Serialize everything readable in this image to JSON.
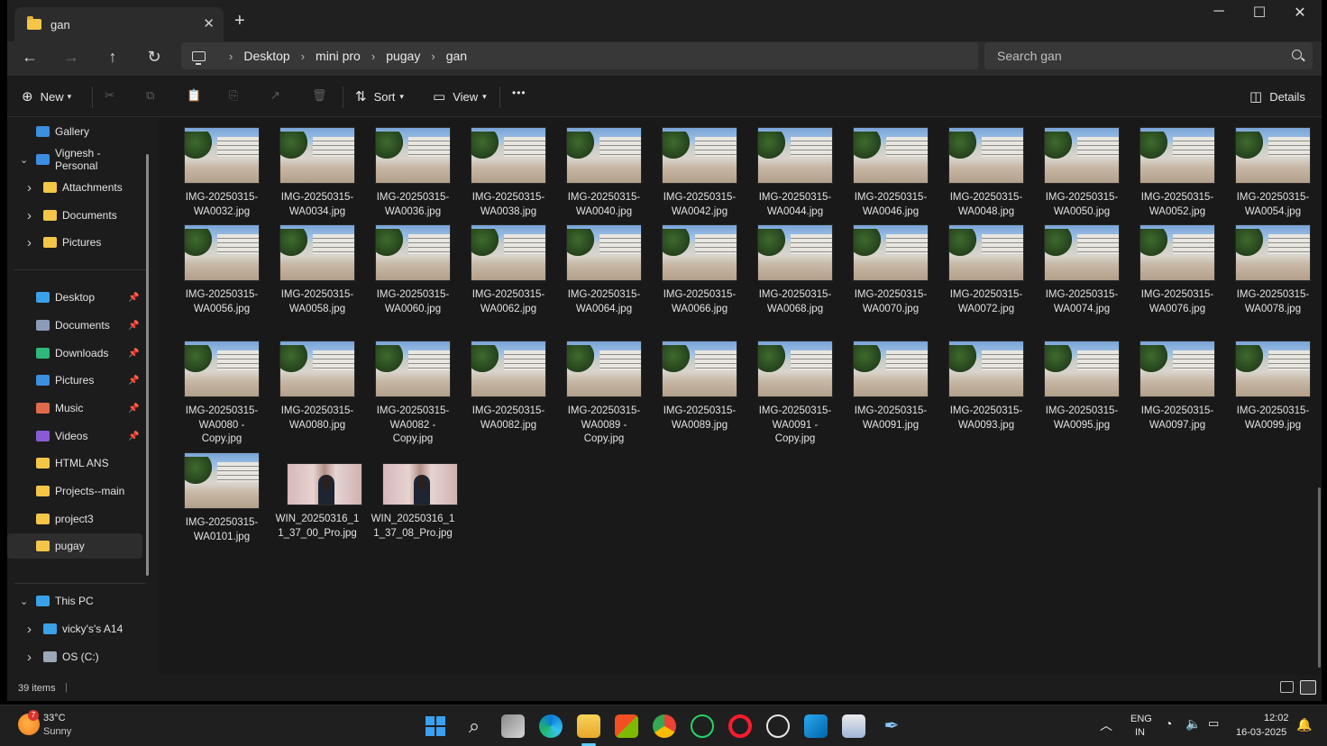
{
  "window": {
    "tab_title": "gan",
    "tab_close": "✕",
    "new_tab": "+",
    "minimize": "─",
    "maximize": "☐",
    "close": "✕"
  },
  "nav": {
    "back": "←",
    "forward": "→",
    "up": "↑",
    "refresh": "↻"
  },
  "address": {
    "crumbs": [
      "Desktop",
      "mini pro",
      "pugay",
      "gan"
    ],
    "separator": "›"
  },
  "search": {
    "placeholder": "Search gan"
  },
  "toolbar": {
    "new_label": "New",
    "sort_label": "Sort",
    "view_label": "View",
    "more_label": "•••",
    "details_label": "Details"
  },
  "sidebar": {
    "items": [
      {
        "label": "Gallery",
        "icon": "gallery-icon",
        "color": "#3b8ee0"
      },
      {
        "label": "Vignesh - Personal",
        "icon": "cloud-icon",
        "color": "#3b8ee0"
      },
      {
        "label": "Attachments",
        "icon": "folder-icon",
        "color": "#f3c648"
      },
      {
        "label": "Documents",
        "icon": "folder-icon",
        "color": "#f3c648"
      },
      {
        "label": "Pictures",
        "icon": "folder-icon",
        "color": "#f3c648"
      },
      {
        "label": "Desktop",
        "icon": "desktop-icon",
        "color": "#3aa0e8"
      },
      {
        "label": "Documents",
        "icon": "document-icon",
        "color": "#8a9bb8"
      },
      {
        "label": "Downloads",
        "icon": "download-icon",
        "color": "#2fb87a"
      },
      {
        "label": "Pictures",
        "icon": "pictures-icon",
        "color": "#3b8ee0"
      },
      {
        "label": "Music",
        "icon": "music-icon",
        "color": "#e06a4a"
      },
      {
        "label": "Videos",
        "icon": "videos-icon",
        "color": "#8a5ad6"
      },
      {
        "label": "HTML ANS",
        "icon": "folder-icon",
        "color": "#f3c648"
      },
      {
        "label": "Projects--main",
        "icon": "folder-icon",
        "color": "#f3c648"
      },
      {
        "label": "project3",
        "icon": "folder-icon",
        "color": "#f3c648"
      },
      {
        "label": "pugay",
        "icon": "folder-icon",
        "color": "#f3c648"
      },
      {
        "label": "This PC",
        "icon": "pc-icon",
        "color": "#3aa0e8"
      },
      {
        "label": "vicky's's A14",
        "icon": "phone-icon",
        "color": "#3aa0e8"
      },
      {
        "label": "OS (C:)",
        "icon": "drive-icon",
        "color": "#9aa7b8"
      }
    ]
  },
  "files": [
    [
      "IMG-20250315-",
      "WA0032.jpg"
    ],
    [
      "IMG-20250315-",
      "WA0034.jpg"
    ],
    [
      "IMG-20250315-",
      "WA0036.jpg"
    ],
    [
      "IMG-20250315-",
      "WA0038.jpg"
    ],
    [
      "IMG-20250315-",
      "WA0040.jpg"
    ],
    [
      "IMG-20250315-",
      "WA0042.jpg"
    ],
    [
      "IMG-20250315-",
      "WA0044.jpg"
    ],
    [
      "IMG-20250315-",
      "WA0046.jpg"
    ],
    [
      "IMG-20250315-",
      "WA0048.jpg"
    ],
    [
      "IMG-20250315-",
      "WA0050.jpg"
    ],
    [
      "IMG-20250315-",
      "WA0052.jpg"
    ],
    [
      "IMG-20250315-",
      "WA0054.jpg"
    ],
    [
      "IMG-20250315-",
      "WA0056.jpg"
    ],
    [
      "IMG-20250315-",
      "WA0058.jpg"
    ],
    [
      "IMG-20250315-",
      "WA0060.jpg"
    ],
    [
      "IMG-20250315-",
      "WA0062.jpg"
    ],
    [
      "IMG-20250315-",
      "WA0064.jpg"
    ],
    [
      "IMG-20250315-",
      "WA0066.jpg"
    ],
    [
      "IMG-20250315-",
      "WA0068.jpg"
    ],
    [
      "IMG-20250315-",
      "WA0070.jpg"
    ],
    [
      "IMG-20250315-",
      "WA0072.jpg"
    ],
    [
      "IMG-20250315-",
      "WA0074.jpg"
    ],
    [
      "IMG-20250315-",
      "WA0076.jpg"
    ],
    [
      "IMG-20250315-",
      "WA0078.jpg"
    ],
    [
      "IMG-20250315-",
      "WA0080 -",
      "Copy.jpg"
    ],
    [
      "IMG-20250315-",
      "WA0080.jpg"
    ],
    [
      "IMG-20250315-",
      "WA0082 -",
      "Copy.jpg"
    ],
    [
      "IMG-20250315-",
      "WA0082.jpg"
    ],
    [
      "IMG-20250315-",
      "WA0089 -",
      "Copy.jpg"
    ],
    [
      "IMG-20250315-",
      "WA0089.jpg"
    ],
    [
      "IMG-20250315-",
      "WA0091 -",
      "Copy.jpg"
    ],
    [
      "IMG-20250315-",
      "WA0091.jpg"
    ],
    [
      "IMG-20250315-",
      "WA0093.jpg"
    ],
    [
      "IMG-20250315-",
      "WA0095.jpg"
    ],
    [
      "IMG-20250315-",
      "WA0097.jpg"
    ],
    [
      "IMG-20250315-",
      "WA0099.jpg"
    ],
    [
      "IMG-20250315-",
      "WA0101.jpg"
    ],
    [
      "WIN_20250316_1",
      "1_37_00_Pro.jpg"
    ],
    [
      "WIN_20250316_1",
      "1_37_08_Pro.jpg"
    ]
  ],
  "status": {
    "items_count": "39 items",
    "separator": "|"
  },
  "taskbar": {
    "weather_temp": "33°C",
    "weather_desc": "Sunny",
    "weather_badge": "7",
    "lang_top": "ENG",
    "lang_bottom": "IN",
    "time": "12:02",
    "date": "16-03-2025",
    "apps": [
      "start-icon",
      "search-icon",
      "task-view-icon",
      "edge-icon",
      "file-explorer-icon",
      "store-icon",
      "chrome-icon",
      "whatsapp-icon",
      "opera-icon",
      "chatgpt-icon",
      "vscode-icon",
      "notepad-icon",
      "pen-icon"
    ]
  }
}
